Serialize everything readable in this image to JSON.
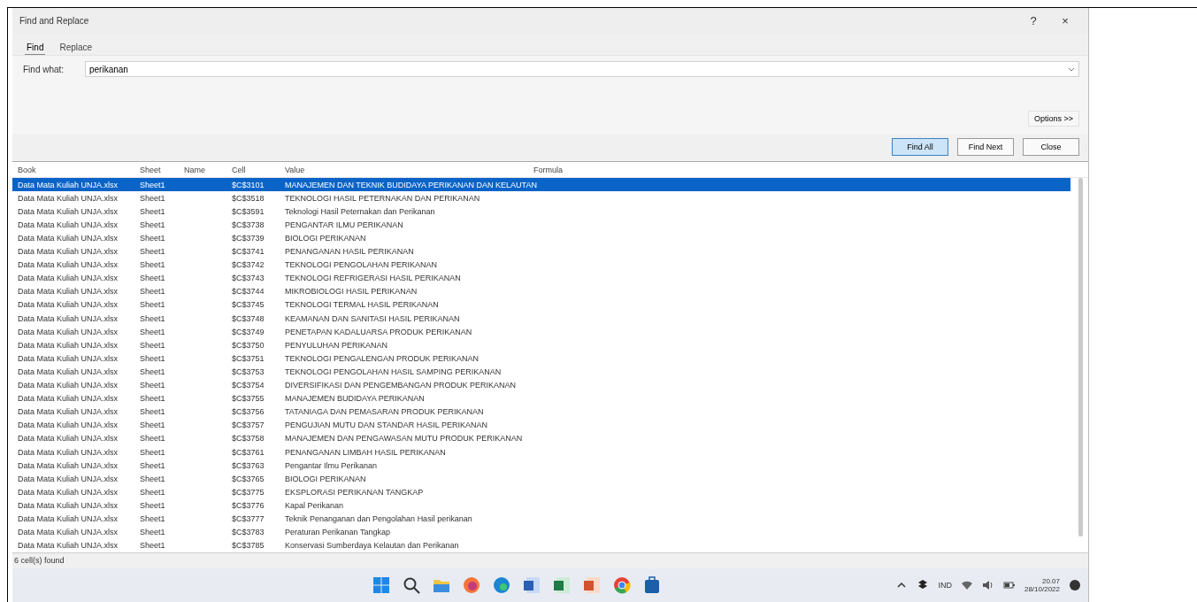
{
  "dialog": {
    "title": "Find and Replace",
    "help_button": "?",
    "close_button": "×",
    "tabs": [
      {
        "label": "Find",
        "selected": true
      },
      {
        "label": "Replace",
        "selected": false
      }
    ],
    "find_what": {
      "label": "Find what:",
      "value": "perikanan"
    },
    "options_button": "Options >>",
    "buttons": [
      {
        "label": "Find All",
        "focused": true
      },
      {
        "label": "Find Next",
        "focused": false
      },
      {
        "label": "Close",
        "focused": false
      }
    ],
    "table": {
      "columns": [
        "Book",
        "Sheet",
        "Name",
        "Cell",
        "Value",
        "Formula"
      ],
      "rows": [
        {
          "book": "Data Mata Kuliah UNJA.xlsx",
          "sheet": "Sheet1",
          "cell": "$C$3101",
          "value": "MANAJEMEN DAN TEKNIK BUDIDAYA PERIKANAN DAN KELAUTAN",
          "selected": true
        },
        {
          "book": "Data Mata Kuliah UNJA.xlsx",
          "sheet": "Sheet1",
          "cell": "$C$3518",
          "value": "TEKNOLOGI HASIL PETERNAKAN DAN PERIKANAN",
          "selected": false
        },
        {
          "book": "Data Mata Kuliah UNJA.xlsx",
          "sheet": "Sheet1",
          "cell": "$C$3591",
          "value": "Teknologi Hasil Peternakan dan Perikanan",
          "selected": false
        },
        {
          "book": "Data Mata Kuliah UNJA.xlsx",
          "sheet": "Sheet1",
          "cell": "$C$3738",
          "value": "PENGANTAR ILMU PERIKANAN",
          "selected": false
        },
        {
          "book": "Data Mata Kuliah UNJA.xlsx",
          "sheet": "Sheet1",
          "cell": "$C$3739",
          "value": "BIOLOGI PERIKANAN",
          "selected": false
        },
        {
          "book": "Data Mata Kuliah UNJA.xlsx",
          "sheet": "Sheet1",
          "cell": "$C$3741",
          "value": "PENANGANAN HASIL PERIKANAN",
          "selected": false
        },
        {
          "book": "Data Mata Kuliah UNJA.xlsx",
          "sheet": "Sheet1",
          "cell": "$C$3742",
          "value": "TEKNOLOGI PENGOLAHAN PERIKANAN",
          "selected": false
        },
        {
          "book": "Data Mata Kuliah UNJA.xlsx",
          "sheet": "Sheet1",
          "cell": "$C$3743",
          "value": "TEKNOLOGI REFRIGERASI HASIL PERIKANAN",
          "selected": false
        },
        {
          "book": "Data Mata Kuliah UNJA.xlsx",
          "sheet": "Sheet1",
          "cell": "$C$3744",
          "value": "MIKROBIOLOGI HASIL PERIKANAN",
          "selected": false
        },
        {
          "book": "Data Mata Kuliah UNJA.xlsx",
          "sheet": "Sheet1",
          "cell": "$C$3745",
          "value": "TEKNOLOGI TERMAL HASIL PERIKANAN",
          "selected": false
        },
        {
          "book": "Data Mata Kuliah UNJA.xlsx",
          "sheet": "Sheet1",
          "cell": "$C$3748",
          "value": "KEAMANAN DAN SANITASI HASIL PERIKANAN",
          "selected": false
        },
        {
          "book": "Data Mata Kuliah UNJA.xlsx",
          "sheet": "Sheet1",
          "cell": "$C$3749",
          "value": "PENETAPAN KADALUARSA PRODUK PERIKANAN",
          "selected": false
        },
        {
          "book": "Data Mata Kuliah UNJA.xlsx",
          "sheet": "Sheet1",
          "cell": "$C$3750",
          "value": "PENYULUHAN PERIKANAN",
          "selected": false
        },
        {
          "book": "Data Mata Kuliah UNJA.xlsx",
          "sheet": "Sheet1",
          "cell": "$C$3751",
          "value": "TEKNOLOGI PENGALENGAN PRODUK PERIKANAN",
          "selected": false
        },
        {
          "book": "Data Mata Kuliah UNJA.xlsx",
          "sheet": "Sheet1",
          "cell": "$C$3753",
          "value": "TEKNOLOGI PENGOLAHAN HASIL SAMPING PERIKANAN",
          "selected": false
        },
        {
          "book": "Data Mata Kuliah UNJA.xlsx",
          "sheet": "Sheet1",
          "cell": "$C$3754",
          "value": "DIVERSIFIKASI DAN PENGEMBANGAN PRODUK PERIKANAN",
          "selected": false
        },
        {
          "book": "Data Mata Kuliah UNJA.xlsx",
          "sheet": "Sheet1",
          "cell": "$C$3755",
          "value": "MANAJEMEN BUDIDAYA PERIKANAN",
          "selected": false
        },
        {
          "book": "Data Mata Kuliah UNJA.xlsx",
          "sheet": "Sheet1",
          "cell": "$C$3756",
          "value": "TATANIAGA DAN PEMASARAN PRODUK PERIKANAN",
          "selected": false
        },
        {
          "book": "Data Mata Kuliah UNJA.xlsx",
          "sheet": "Sheet1",
          "cell": "$C$3757",
          "value": "PENGUJIAN MUTU DAN STANDAR HASIL PERIKANAN",
          "selected": false
        },
        {
          "book": "Data Mata Kuliah UNJA.xlsx",
          "sheet": "Sheet1",
          "cell": "$C$3758",
          "value": "MANAJEMEN DAN PENGAWASAN MUTU PRODUK PERIKANAN",
          "selected": false
        },
        {
          "book": "Data Mata Kuliah UNJA.xlsx",
          "sheet": "Sheet1",
          "cell": "$C$3761",
          "value": "PENANGANAN LIMBAH HASIL PERIKANAN",
          "selected": false
        },
        {
          "book": "Data Mata Kuliah UNJA.xlsx",
          "sheet": "Sheet1",
          "cell": "$C$3763",
          "value": "Pengantar Ilmu Perikanan",
          "selected": false
        },
        {
          "book": "Data Mata Kuliah UNJA.xlsx",
          "sheet": "Sheet1",
          "cell": "$C$3765",
          "value": "BIOLOGI PERIKANAN",
          "selected": false
        },
        {
          "book": "Data Mata Kuliah UNJA.xlsx",
          "sheet": "Sheet1",
          "cell": "$C$3775",
          "value": "EKSPLORASI PERIKANAN TANGKAP",
          "selected": false
        },
        {
          "book": "Data Mata Kuliah UNJA.xlsx",
          "sheet": "Sheet1",
          "cell": "$C$3776",
          "value": "Kapal Perikanan",
          "selected": false
        },
        {
          "book": "Data Mata Kuliah UNJA.xlsx",
          "sheet": "Sheet1",
          "cell": "$C$3777",
          "value": "Teknik Penanganan dan Pengolahan Hasil perikanan",
          "selected": false
        },
        {
          "book": "Data Mata Kuliah UNJA.xlsx",
          "sheet": "Sheet1",
          "cell": "$C$3783",
          "value": "Peraturan Perikanan Tangkap",
          "selected": false
        },
        {
          "book": "Data Mata Kuliah UNJA.xlsx",
          "sheet": "Sheet1",
          "cell": "$C$3785",
          "value": "Konservasi Sumberdaya Kelautan dan Perikanan",
          "selected": false
        }
      ]
    },
    "status_bar": "6 cell(s) found"
  },
  "taskbar": {
    "apps": [
      {
        "kind": "start"
      },
      {
        "kind": "search"
      },
      {
        "kind": "folder"
      },
      {
        "kind": "firefox"
      },
      {
        "kind": "edge"
      },
      {
        "kind": "word"
      },
      {
        "kind": "excel"
      },
      {
        "kind": "powerpoint"
      },
      {
        "kind": "chrome"
      },
      {
        "kind": "store"
      }
    ],
    "tray": {
      "language": "IND",
      "time": "20.07",
      "date": "28/10/2022"
    }
  }
}
